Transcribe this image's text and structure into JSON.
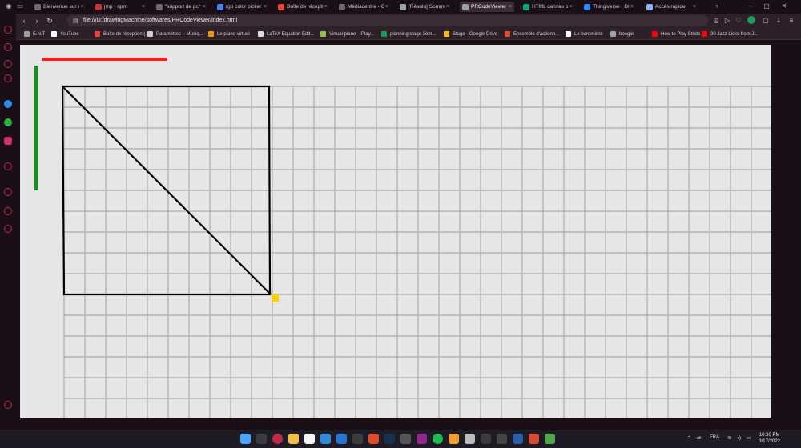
{
  "browser": {
    "tabs": [
      {
        "label": "Bienvenue sur vi",
        "fav_color": "#6b6b6b"
      },
      {
        "label": "jmp - npm",
        "fav_color": "#cb3837"
      },
      {
        "label": "\"support de pc\"",
        "fav_color": "#6b6b6b"
      },
      {
        "label": "rgb color picker",
        "fav_color": "#4285f4"
      },
      {
        "label": "Boîte de réceptio",
        "fav_color": "#ea4335"
      },
      {
        "label": "Médiacentre - Co",
        "fav_color": "#6b6b6b"
      },
      {
        "label": "[Résolu] Somme",
        "fav_color": "#9aa0a6"
      },
      {
        "label": "PRCodeViewer",
        "fav_color": "#9aa0a6",
        "active": true
      },
      {
        "label": "HTML canvas bey",
        "fav_color": "#04aa6d"
      },
      {
        "label": "Thingiverse - Dig",
        "fav_color": "#248bfb"
      },
      {
        "label": "Accès rapide",
        "fav_color": "#8ab4f8"
      }
    ],
    "new_tab_label": "+",
    "url": "file:///D:/drawingMachine/softwares/PRCodeViewer/index.html",
    "bookmarks": [
      {
        "label": "E.N.T",
        "color": "#9aa0a6"
      },
      {
        "label": "YouTube",
        "color": "#ffffff"
      },
      {
        "label": "Boîte de réception (...",
        "color": "#ea4335"
      },
      {
        "label": "Paramètres – Musiq...",
        "color": "#cccccc"
      },
      {
        "label": "Le piano virtuel",
        "color": "#f29900"
      },
      {
        "label": "LaTeX Equation Edit...",
        "color": "#dddddd"
      },
      {
        "label": "Virtual piano – Play...",
        "color": "#8bc34a"
      },
      {
        "label": "planning stage 3èm...",
        "color": "#0f9d58"
      },
      {
        "label": "Stage - Google Drive",
        "color": "#fbbc04"
      },
      {
        "label": "Ensemble d'actionn...",
        "color": "#e04b2a"
      },
      {
        "label": "Le baromètre",
        "color": "#ffffff"
      },
      {
        "label": "boogie",
        "color": "#9aa0a6"
      },
      {
        "label": "How to Play Stride...",
        "color": "#ff0000"
      },
      {
        "label": "30 Jazz Licks from J...",
        "color": "#ff0000"
      }
    ]
  },
  "taskbar": {
    "lang": "FRA",
    "time": "10:30 PM",
    "date": "3/17/2022"
  },
  "colors": {
    "grid_line": "#b4b4b4",
    "red_axis": "#ff1a1a",
    "green_axis": "#0a9a0a",
    "shape_stroke": "#000000",
    "cursor": "#ffd000"
  }
}
